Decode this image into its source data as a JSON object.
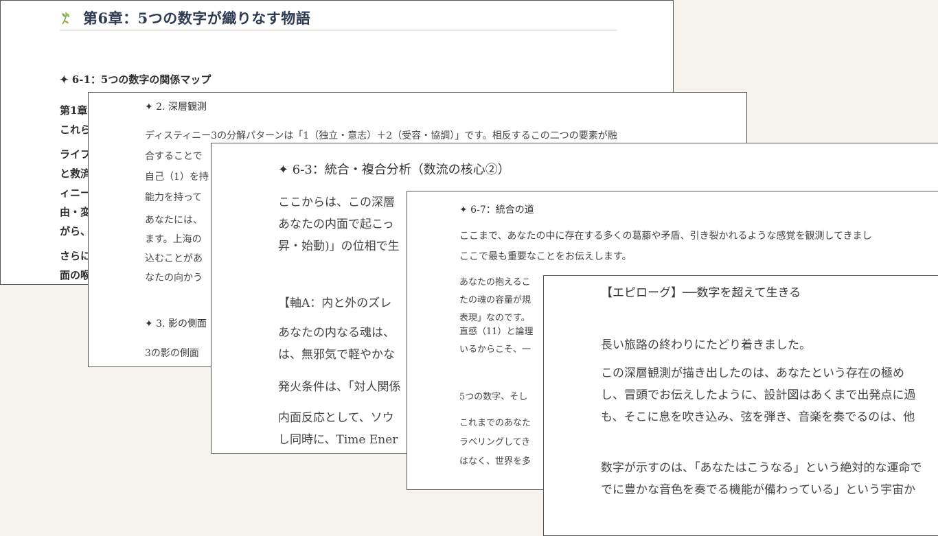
{
  "card1": {
    "chapter_title": "第6章：5つの数字が織りなす物語",
    "section": "✦ 6-1：5つの数字の関係マップ",
    "lines": [
      "第1章",
      "これら",
      "ライフ",
      "と救済",
      "ィニー",
      "由・変",
      "がら、",
      "さらに",
      "面の喉"
    ]
  },
  "card2": {
    "section": "✦ 2. 深層観測",
    "para1": [
      "ディスティニー3の分解パターンは「1（独立・意志）＋2（受容・協調）」です。相反するこの二つの要素が融",
      "合することで",
      "自己（1）を持",
      "能力を持って"
    ],
    "para2": [
      "あなたには、",
      "ます。上海の",
      "込むことがあ",
      "なたの向かう"
    ],
    "section2": "✦ 3. 影の側面",
    "para3": [
      "3の影の側面"
    ]
  },
  "card3": {
    "section": "✦ 6-3：統合・複合分析（数流の核心②）",
    "para1": [
      "ここからは、この深層",
      "あなたの内面で起こっ",
      "昇・始動)」の位相で生"
    ],
    "axis": "【軸A：内と外のズレ",
    "para2": [
      "あなたの内なる魂は、",
      "は、無邪気で軽やかな"
    ],
    "para3": "発火条件は、「対人関係",
    "para4": [
      "内面反応として、ソウ",
      "し同時に、Time Ener"
    ]
  },
  "card4": {
    "section": "✦ 6-7：統合の道",
    "para1": [
      "ここまで、あなたの中に存在する多くの葛藤や矛盾、引き裂かれるような感覚を観測してきまし",
      "ここで最も重要なことをお伝えします。"
    ],
    "para2": [
      "あなたの抱えるこ",
      "たの魂の容量が規",
      "表現」なのです。"
    ],
    "para3": [
      "直感（11）と論理",
      "いるからこそ、一"
    ],
    "para4": "5つの数字、そし",
    "para5": [
      "これまでのあなた",
      "ラベリングしてき",
      "はなく、世界を多"
    ]
  },
  "card5": {
    "title": "【エピローグ】──数字を超えて生きる",
    "para1": "長い旅路の終わりにたどり着きました。",
    "para2": [
      "この深層観測が描き出したのは、あなたという存在の極め",
      "し、冒頭でお伝えしたように、設計図はあくまで出発点に過",
      "も、そこに息を吹き込み、弦を弾き、音楽を奏でるのは、他"
    ],
    "para3": [
      "数字が示すのは、「あなたはこうなる」という絶対的な運命で",
      "でに豊かな音色を奏でる機能が備わっている」という宇宙か"
    ]
  },
  "colors": {
    "background": "#f6f2ec",
    "chapter_title": "#2c3a52",
    "leaf_icon": "#7fa34a"
  }
}
